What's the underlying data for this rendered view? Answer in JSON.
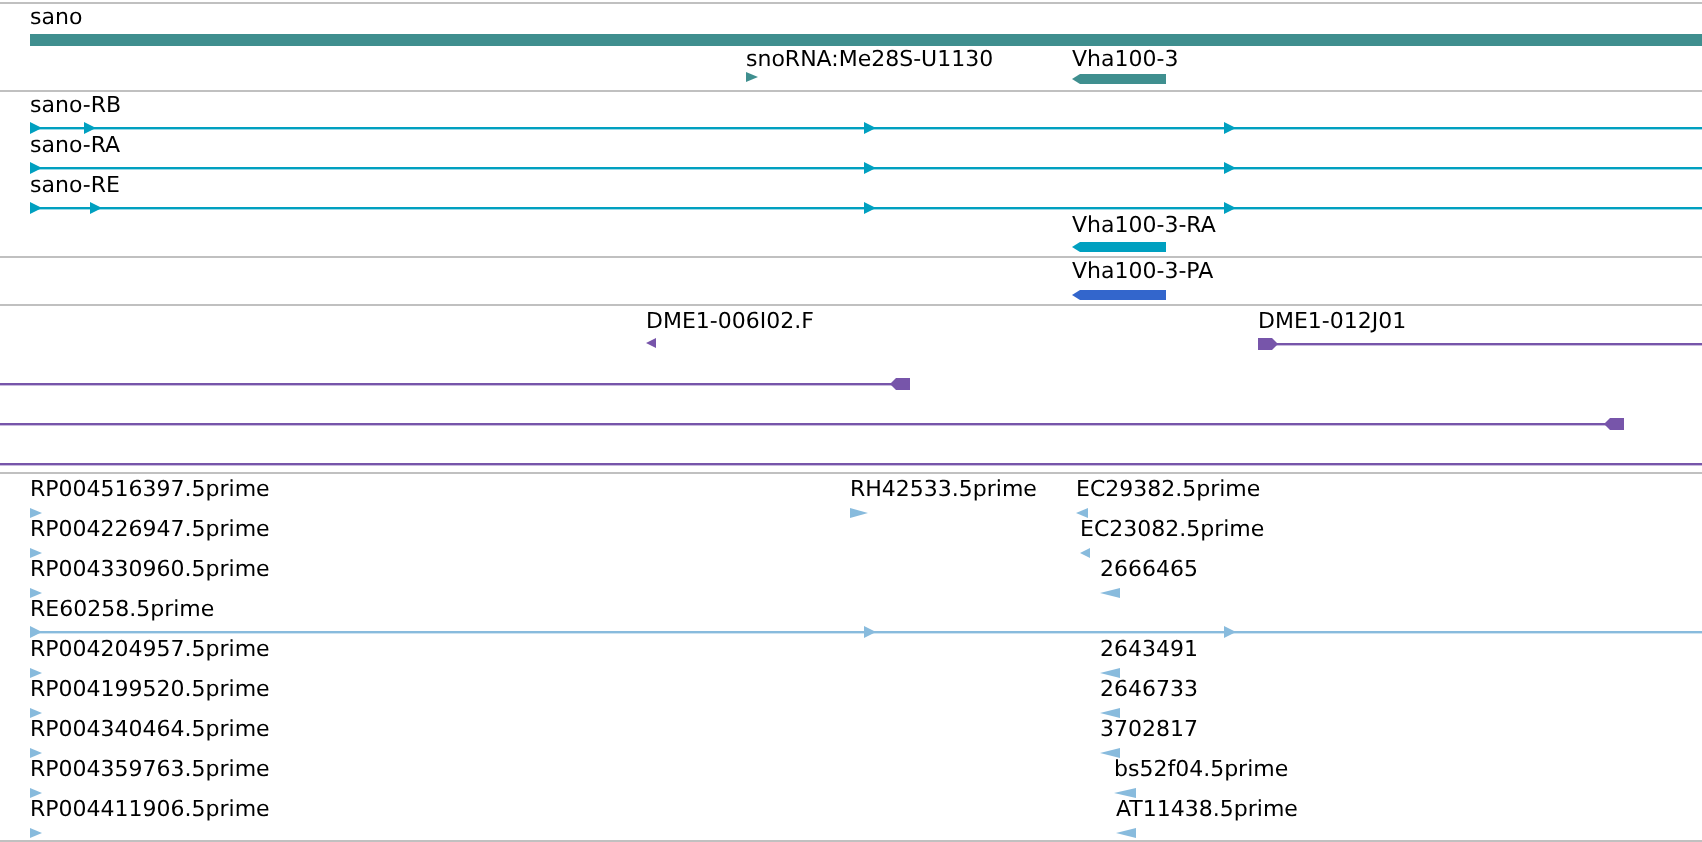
{
  "tracks": [
    {
      "color": "#3f8f8f",
      "features": [
        {
          "kind": "bar",
          "label": "sano"
        },
        {
          "kind": "mark",
          "label": "snoRNA:Me28S-U1130",
          "reverse": false
        },
        {
          "kind": "bar",
          "label": "Vha100-3",
          "reverse": true
        }
      ]
    },
    {
      "color": "#00a0c0",
      "features": [
        {
          "kind": "line",
          "label": "sano-RB",
          "reverse": false
        },
        {
          "kind": "line",
          "label": "sano-RA",
          "reverse": false
        },
        {
          "kind": "line",
          "label": "sano-RE",
          "reverse": false
        },
        {
          "kind": "bar",
          "label": "Vha100-3-RA",
          "reverse": true
        }
      ]
    },
    {
      "color": "#3366cc",
      "features": [
        {
          "kind": "bar",
          "label": "Vha100-3-PA",
          "reverse": true
        }
      ]
    },
    {
      "color": "#7755aa",
      "features": [
        {
          "kind": "mark",
          "label": "DME1-006I02.F",
          "reverse": true
        },
        {
          "kind": "headline",
          "label": "DME1-012J01",
          "reverse": false
        },
        {
          "kind": "headline",
          "reverse": true
        },
        {
          "kind": "headline",
          "reverse": true
        },
        {
          "kind": "headline"
        }
      ]
    },
    {
      "color": "#88bbdd",
      "features": [
        {
          "kind": "mark",
          "label": "RP004516397.5prime",
          "reverse": false
        },
        {
          "kind": "mark",
          "label": "RH42533.5prime",
          "reverse": false
        },
        {
          "kind": "mark",
          "label": "EC29382.5prime",
          "reverse": true
        },
        {
          "kind": "mark",
          "label": "RP004226947.5prime",
          "reverse": false
        },
        {
          "kind": "mark",
          "label": "EC23082.5prime",
          "reverse": true
        },
        {
          "kind": "mark",
          "label": "RP004330960.5prime",
          "reverse": false
        },
        {
          "kind": "mark",
          "label": "2666465",
          "reverse": true
        },
        {
          "kind": "line",
          "label": "RE60258.5prime",
          "reverse": false
        },
        {
          "kind": "mark",
          "label": "RP004204957.5prime",
          "reverse": false
        },
        {
          "kind": "mark",
          "label": "2643491",
          "reverse": true
        },
        {
          "kind": "mark",
          "label": "RP004199520.5prime",
          "reverse": false
        },
        {
          "kind": "mark",
          "label": "2646733",
          "reverse": true
        },
        {
          "kind": "mark",
          "label": "RP004340464.5prime",
          "reverse": false
        },
        {
          "kind": "mark",
          "label": "3702817",
          "reverse": true
        },
        {
          "kind": "mark",
          "label": "RP004359763.5prime",
          "reverse": false
        },
        {
          "kind": "mark",
          "label": "bs52f04.5prime",
          "reverse": true
        },
        {
          "kind": "mark",
          "label": "RP004411906.5prime",
          "reverse": false
        },
        {
          "kind": "mark",
          "label": "AT11438.5prime",
          "reverse": true
        }
      ]
    }
  ]
}
